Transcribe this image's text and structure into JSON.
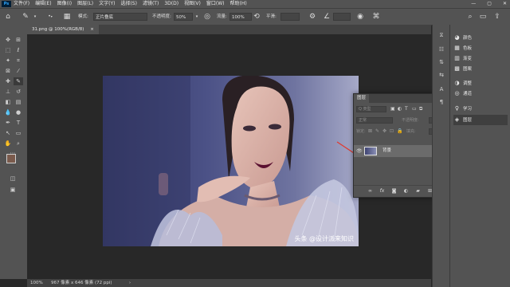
{
  "menubar": {
    "logo": "Ps",
    "items": [
      "文件(F)",
      "编辑(E)",
      "图像(I)",
      "图层(L)",
      "文字(Y)",
      "选择(S)",
      "滤镜(T)",
      "3D(D)",
      "视图(V)",
      "窗口(W)",
      "帮助(H)"
    ],
    "win_min": "—",
    "win_max": "▢",
    "win_close": "✕"
  },
  "options": {
    "mode_label": "模式:",
    "mode_value": "正片叠底",
    "opacity_label": "不透明度:",
    "opacity_value": "50%",
    "flow_label": "流量:",
    "flow_value": "100%",
    "smooth_label": "平滑:"
  },
  "document": {
    "tab_title": "31.png @ 100%(RGB/8)",
    "tab_close": "×",
    "watermark": "头条 @设计派来知识"
  },
  "status": {
    "zoom": "100%",
    "doc_info": "967 像素 x 646 像素 (72 ppi)"
  },
  "layers_panel": {
    "tab_label": "图层",
    "collapse": "»",
    "menu": "≡",
    "kind_placeholder": "Q 类型",
    "blend_value": "正常",
    "opacity_label": "不透明度:",
    "lock_label": "锁定:",
    "fill_label": "填充:",
    "layer_name": "背景",
    "footer_fx": "fx"
  },
  "right_panels": {
    "items": [
      {
        "label": "颜色",
        "icon": "color-wheel-icon"
      },
      {
        "label": "色板",
        "icon": "swatches-icon"
      },
      {
        "label": "渐变",
        "icon": "gradient-icon"
      },
      {
        "label": "图案",
        "icon": "pattern-icon"
      },
      {
        "label": "调整",
        "icon": "adjustments-icon"
      },
      {
        "label": "通道",
        "icon": "channels-icon"
      },
      {
        "label": "学习",
        "icon": "learn-icon"
      },
      {
        "label": "图层",
        "icon": "layers-icon"
      }
    ]
  },
  "colors": {
    "foreground": "#7a5a4c",
    "background": "#1f6fe0",
    "arrow": "#e03a2f"
  }
}
